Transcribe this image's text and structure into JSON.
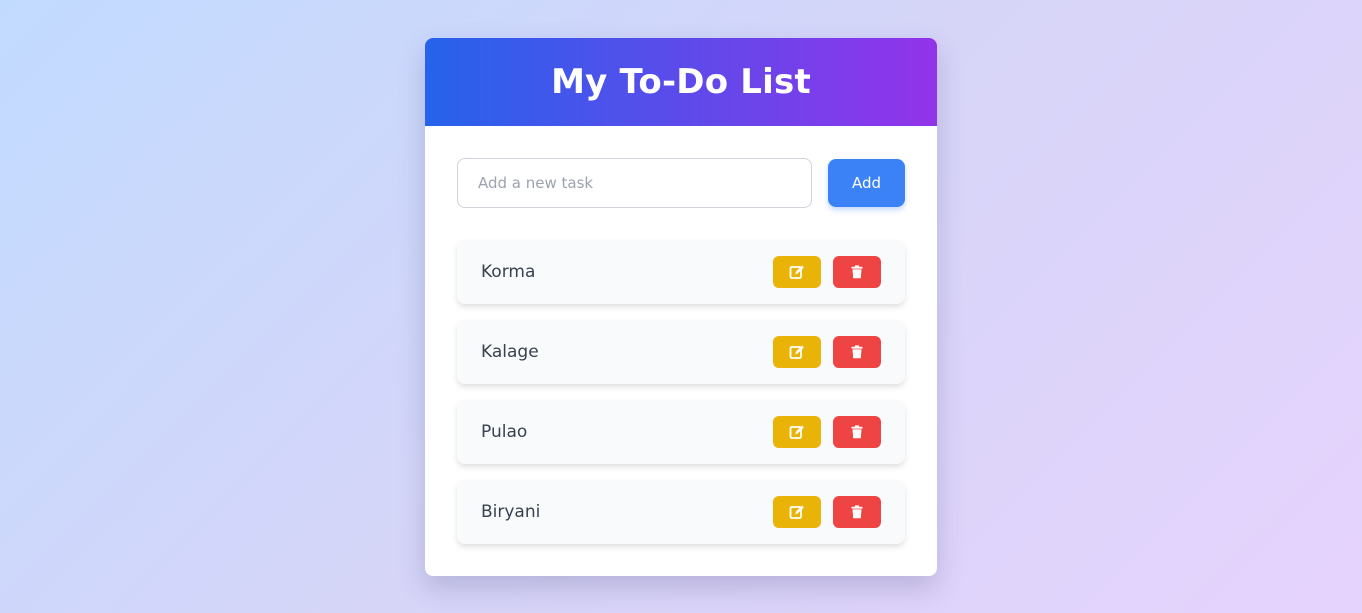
{
  "app": {
    "title": "My To-Do List"
  },
  "add_form": {
    "input_value": "",
    "input_placeholder": "Add a new task",
    "add_label": "Add"
  },
  "tasks": [
    {
      "label": "Korma"
    },
    {
      "label": "Kalage"
    },
    {
      "label": "Pulao"
    },
    {
      "label": "Biryani"
    }
  ],
  "icons": {
    "edit": "pencil-square-icon",
    "delete": "trash-icon"
  },
  "colors": {
    "header_gradient_start": "#2563eb",
    "header_gradient_end": "#9333ea",
    "add_button": "#3b82f6",
    "edit_button": "#eab308",
    "delete_button": "#ef4444"
  }
}
